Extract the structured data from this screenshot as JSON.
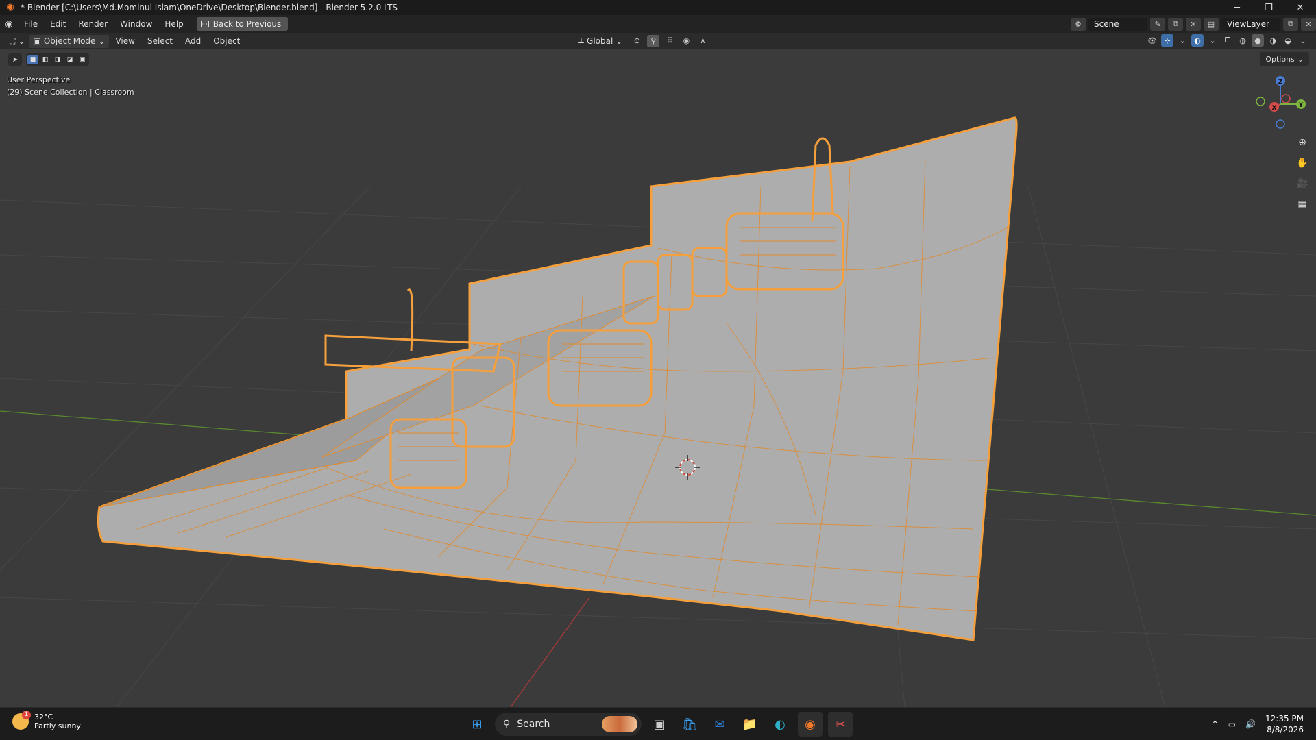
{
  "window": {
    "title": "* Blender [C:\\Users\\Md.Mominul Islam\\OneDrive\\Desktop\\Blender.blend] - Blender 5.2.0 LTS",
    "controls": [
      "minimize",
      "restore",
      "close"
    ]
  },
  "menubar": {
    "items": [
      "File",
      "Edit",
      "Render",
      "Window",
      "Help"
    ],
    "back_button": "Back to Previous",
    "scene": "Scene",
    "view_layer": "ViewLayer"
  },
  "header": {
    "mode": "Object Mode",
    "menus": [
      "View",
      "Select",
      "Add",
      "Object"
    ],
    "transform_orientation": "Global"
  },
  "viewport": {
    "perspective": "User Perspective",
    "collection": "(29) Scene Collection | Classroom",
    "options_label": "Options",
    "gizmo_axes": [
      "Z",
      "Y",
      "X"
    ],
    "colors": {
      "selection_outline": "#f5a03c",
      "mesh_surface": "#b0b0b0",
      "wire": "#e08a2e",
      "x_axis": "#b03a3a",
      "y_axis": "#4f8a2b",
      "grid": "#4a4a4a"
    }
  },
  "taskbar": {
    "temperature": "32°C",
    "weather": "Partly sunny",
    "weather_badge": "1",
    "search_placeholder": "Search",
    "time": "12:35 PM",
    "date": "8/8/2026"
  }
}
